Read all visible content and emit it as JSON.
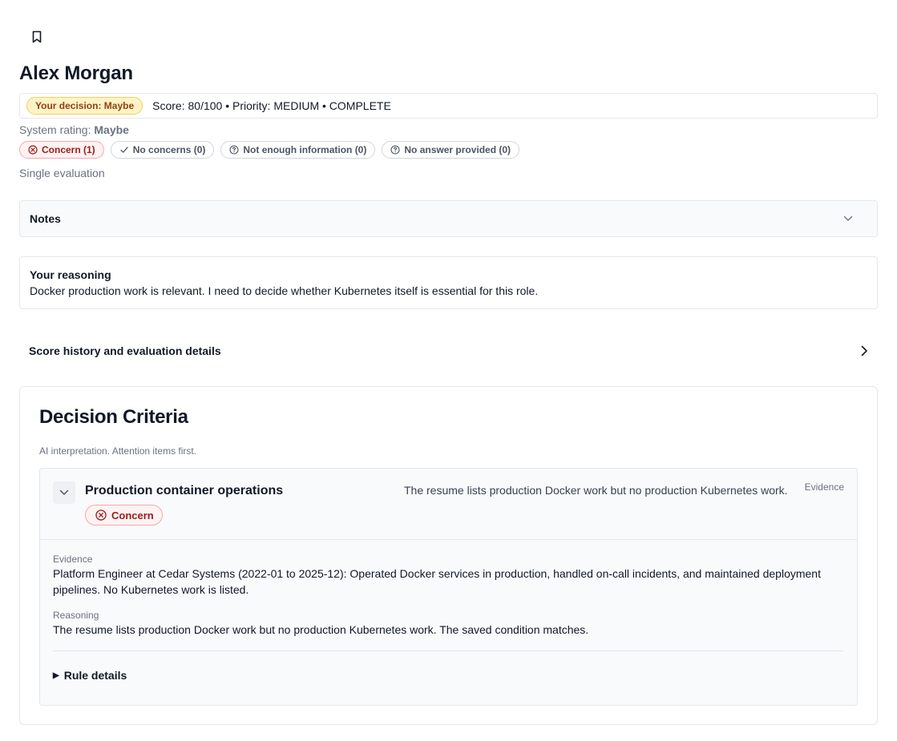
{
  "candidate": {
    "name": "Alex Morgan"
  },
  "decision": {
    "badge": "Your decision: Maybe",
    "summary": "Score: 80/100 • Priority: MEDIUM • COMPLETE"
  },
  "system_rating": {
    "label": "System rating:",
    "value": "Maybe"
  },
  "chips": [
    {
      "label": "Concern (1)",
      "icon": "x-circle-icon"
    },
    {
      "label": "No concerns (0)",
      "icon": "check-icon"
    },
    {
      "label": "Not enough information (0)",
      "icon": "question-circle-icon"
    },
    {
      "label": "No answer provided (0)",
      "icon": "question-circle-icon"
    }
  ],
  "evaluation_mode": "Single evaluation",
  "notes": {
    "title": "Notes"
  },
  "your_reasoning": {
    "title": "Your reasoning",
    "text": "Docker production work is relevant. I need to decide whether Kubernetes itself is essential for this role."
  },
  "history": {
    "title": "Score history and evaluation details"
  },
  "criteria": {
    "title": "Decision Criteria",
    "subtitle": "AI interpretation. Attention items first.",
    "items": [
      {
        "name": "Production container operations",
        "status": "Concern",
        "summary": "The resume lists production Docker work but no production Kubernetes work.",
        "evidence_link": "Evidence",
        "evidence_label": "Evidence",
        "evidence_text": "Platform Engineer at Cedar Systems (2022-01 to 2025-12): Operated Docker services in production, handled on-call incidents, and maintained deployment pipelines. No Kubernetes work is listed.",
        "reasoning_label": "Reasoning",
        "reasoning_text": "The resume lists production Docker work but no production Kubernetes work. The saved condition matches.",
        "rule_details": "Rule details"
      }
    ]
  },
  "colors": {
    "concern": "#991b1b",
    "maybe_badge_bg": "#fef3c7",
    "maybe_badge_text": "#92400e"
  }
}
